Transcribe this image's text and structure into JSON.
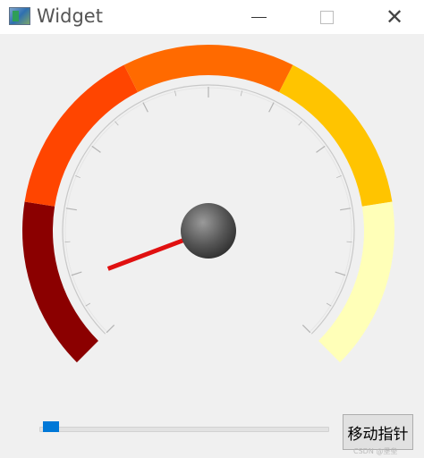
{
  "window": {
    "title": "Widget",
    "icon": "app-window-icon",
    "controls": [
      "minimize-icon",
      "maximize-icon",
      "close-icon"
    ]
  },
  "gauge": {
    "pointer_value": 0.09,
    "bands": [
      {
        "from": 0.0,
        "to": 0.2,
        "color": "#8b0000"
      },
      {
        "from": 0.2,
        "to": 0.4,
        "color": "#ff4500"
      },
      {
        "from": 0.4,
        "to": 0.6,
        "color": "#ff6a00"
      },
      {
        "from": 0.6,
        "to": 0.8,
        "color": "#ffc400"
      },
      {
        "from": 0.8,
        "to": 1.0,
        "color": "#ffffb8"
      }
    ],
    "needle_color": "#e01010",
    "hub_color": "#4a4a4a"
  },
  "controls": {
    "slider_value": 0.0,
    "button_label": "移动指针",
    "accent": "#0078d7"
  },
  "watermark": "CSDN @堡垒"
}
